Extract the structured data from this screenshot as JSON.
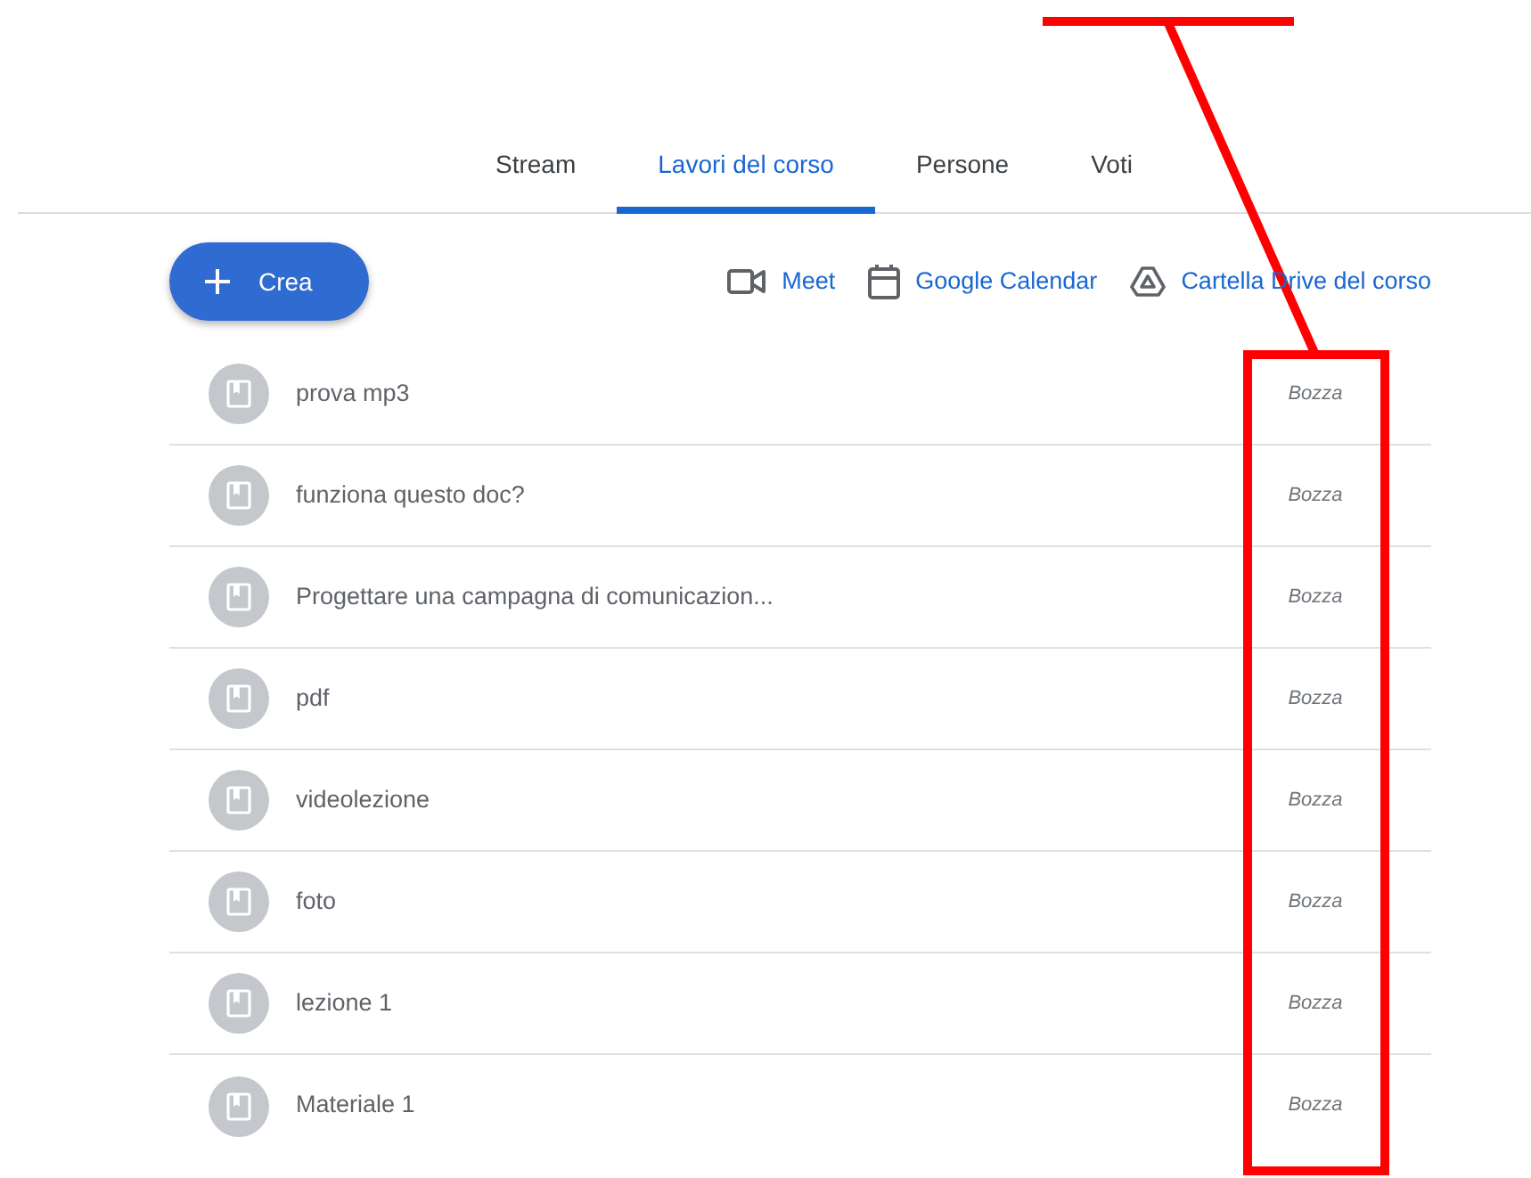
{
  "tabs": [
    {
      "label": "Stream",
      "selected": false
    },
    {
      "label": "Lavori del corso",
      "selected": true
    },
    {
      "label": "Persone",
      "selected": false
    },
    {
      "label": "Voti",
      "selected": false
    }
  ],
  "create_button": {
    "label": "Crea"
  },
  "links": [
    {
      "kind": "meet",
      "label": "Meet"
    },
    {
      "kind": "calendar",
      "label": "Google Calendar"
    },
    {
      "kind": "drive",
      "label": "Cartella Drive del corso"
    }
  ],
  "items": [
    {
      "title": "prova mp3",
      "status": "Bozza"
    },
    {
      "title": "funziona questo doc?",
      "status": "Bozza"
    },
    {
      "title": "Progettare una campagna di comunicazion...",
      "status": "Bozza"
    },
    {
      "title": "pdf",
      "status": "Bozza"
    },
    {
      "title": "videolezione",
      "status": "Bozza"
    },
    {
      "title": "foto",
      "status": "Bozza"
    },
    {
      "title": "lezione 1",
      "status": "Bozza"
    },
    {
      "title": "Materiale 1",
      "status": "Bozza"
    }
  ]
}
